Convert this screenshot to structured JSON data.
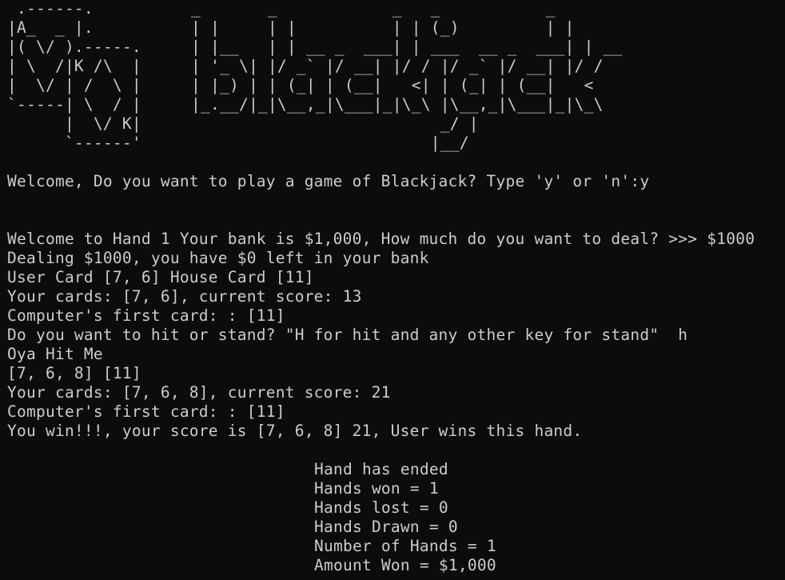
{
  "terminal": {
    "background": "#0c0c0c",
    "foreground": "#cccccc"
  },
  "ascii_card_art": " .------.\n|A_  _ |.\n|( \\/ ).-----.\n| \\  /|K /\\  |\n|  \\/ | /  \\ |\n`-----| \\  / |\n      |  \\/ K|\n      `------'",
  "ascii_title_art": "_       _            _   _           _\n| |     | |          | | (_)         | |\n| |__   | | __ _  ___| | ___  __ _  ___| | __\n| '_ \\| |/ _` |/ __| |/ / |/ _` |/ __| |/ /\n| |_) | | (_| | (__|   <| | (_| | (__|   <\n|_.__/|_|\\__,_|\\___|_|\\_\\ |\\__,_|\\___|_|\\_\\\n                          _/ |\n                         |__/",
  "lines": {
    "welcome_prompt": "Welcome, Do you want to play a game of Blackjack? Type 'y' or 'n':y",
    "hand_prompt": "Welcome to Hand 1 Your bank is $1,000, How much do you want to deal? >>> $1000",
    "dealing": "Dealing $1000, you have $0 left in your bank",
    "user_house_cards": "User Card [7, 6] House Card [11]",
    "your_cards_1": "Your cards: [7, 6], current score: 13",
    "computer_first_1": "Computer's first card: : [11]",
    "hit_or_stand": "Do you want to hit or stand? \"H for hit and any other key for stand\"  h",
    "oya_hit": "Oya Hit Me",
    "cards_after_hit": "[7, 6, 8] [11]",
    "your_cards_2": "Your cards: [7, 6, 8], current score: 21",
    "computer_first_2": "Computer's first card: : [11]",
    "win_message": "You win!!!, your score is [7, 6, 8] 21, User wins this hand."
  },
  "summary": {
    "hand_ended": "Hand has ended",
    "hands_won": "Hands won = 1",
    "hands_lost": "Hands lost = 0",
    "hands_drawn": "Hands Drawn = 0",
    "number_of_hands": "Number of Hands = 1",
    "amount_won": "Amount Won = $1,000"
  }
}
